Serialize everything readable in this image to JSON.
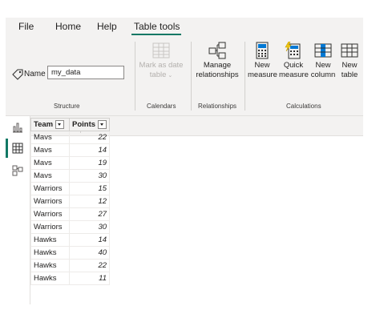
{
  "menu": {
    "tabs": [
      {
        "label": "File"
      },
      {
        "label": "Home"
      },
      {
        "label": "Help"
      },
      {
        "label": "Table tools"
      }
    ]
  },
  "ribbon": {
    "structure": {
      "name_label": "Name",
      "name_value": "my_data",
      "group_label": "Structure",
      "icon": "tag-icon"
    },
    "calendars": {
      "mark_date_line1": "Mark as date",
      "mark_date_line2": "table",
      "group_label": "Calendars",
      "icon": "calendar-table-icon"
    },
    "relationships": {
      "manage_line1": "Manage",
      "manage_line2": "relationships",
      "group_label": "Relationships",
      "icon": "relationships-icon"
    },
    "calculations": {
      "new_measure_line1": "New",
      "new_measure_line2": "measure",
      "quick_measure_line1": "Quick",
      "quick_measure_line2": "measure",
      "new_column_line1": "New",
      "new_column_line2": "column",
      "new_table_line1": "New",
      "new_table_line2": "table",
      "group_label": "Calculations"
    }
  },
  "rail": {
    "items": [
      {
        "icon": "report-view-icon"
      },
      {
        "icon": "table-view-icon"
      },
      {
        "icon": "model-view-icon"
      }
    ]
  },
  "colors": {
    "accent": "#117865",
    "ribbon_bg": "#f3f2f1"
  },
  "table": {
    "columns": [
      "Team",
      "Points"
    ],
    "rows": [
      [
        "Mavs",
        "22"
      ],
      [
        "Mavs",
        "14"
      ],
      [
        "Mavs",
        "19"
      ],
      [
        "Mavs",
        "30"
      ],
      [
        "Warriors",
        "15"
      ],
      [
        "Warriors",
        "12"
      ],
      [
        "Warriors",
        "27"
      ],
      [
        "Warriors",
        "30"
      ],
      [
        "Hawks",
        "14"
      ],
      [
        "Hawks",
        "40"
      ],
      [
        "Hawks",
        "22"
      ],
      [
        "Hawks",
        "11"
      ]
    ]
  }
}
